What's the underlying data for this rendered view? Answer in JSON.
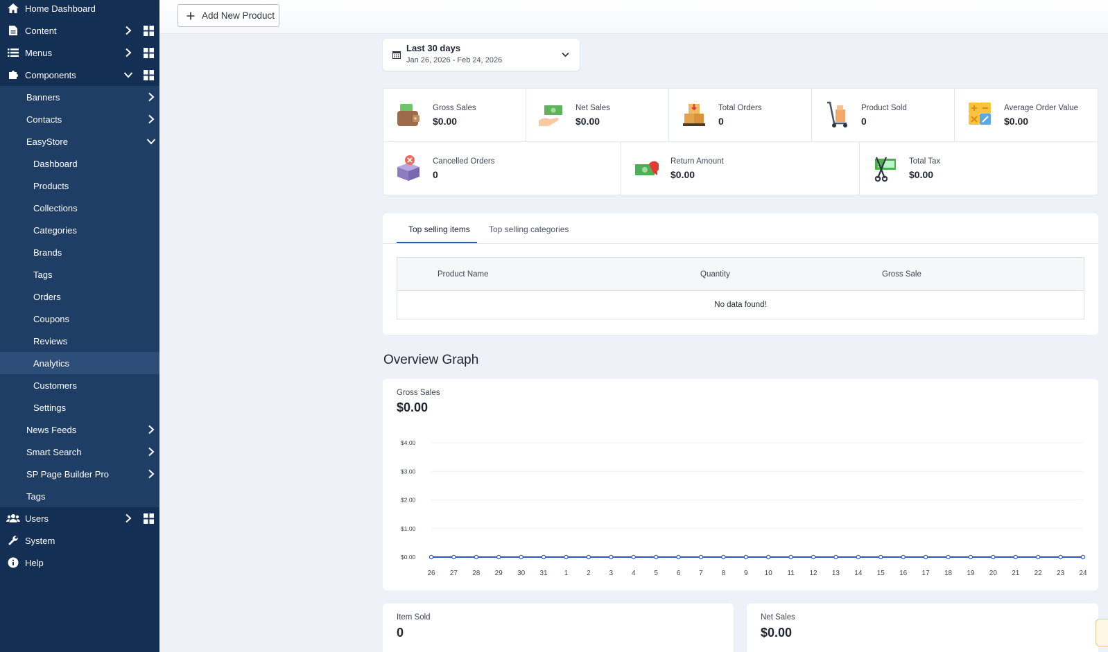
{
  "sidebar": {
    "items": [
      {
        "label": "Home Dashboard"
      },
      {
        "label": "Content"
      },
      {
        "label": "Menus"
      },
      {
        "label": "Components"
      },
      {
        "label": "Banners"
      },
      {
        "label": "Contacts"
      },
      {
        "label": "EasyStore"
      },
      {
        "label": "Dashboard"
      },
      {
        "label": "Products"
      },
      {
        "label": "Collections"
      },
      {
        "label": "Categories"
      },
      {
        "label": "Brands"
      },
      {
        "label": "Tags"
      },
      {
        "label": "Orders"
      },
      {
        "label": "Coupons"
      },
      {
        "label": "Reviews"
      },
      {
        "label": "Analytics"
      },
      {
        "label": "Customers"
      },
      {
        "label": "Settings"
      },
      {
        "label": "News Feeds"
      },
      {
        "label": "Smart Search"
      },
      {
        "label": "SP Page Builder Pro"
      },
      {
        "label": "Tags"
      },
      {
        "label": "Users"
      },
      {
        "label": "System"
      },
      {
        "label": "Help"
      }
    ],
    "active": "Analytics"
  },
  "toolbar": {
    "add_label": "Add New Product"
  },
  "date_range": {
    "label": "Last 30 days",
    "range": "Jan 26, 2026 - Feb 24, 2026"
  },
  "metrics": [
    {
      "label": "Gross Sales",
      "value": "$0.00",
      "icon": "wallet-icon"
    },
    {
      "label": "Net Sales",
      "value": "$0.00",
      "icon": "cash-hand-icon"
    },
    {
      "label": "Total Orders",
      "value": "0",
      "icon": "boxes-icon"
    },
    {
      "label": "Product Sold",
      "value": "0",
      "icon": "hand-truck-icon"
    },
    {
      "label": "Average Order Value",
      "value": "$0.00",
      "icon": "calculator-icon"
    },
    {
      "label": "Cancelled Orders",
      "value": "0",
      "icon": "cancel-box-icon"
    },
    {
      "label": "Return Amount",
      "value": "$0.00",
      "icon": "money-return-icon"
    },
    {
      "label": "Total Tax",
      "value": "$0.00",
      "icon": "tax-scissors-icon"
    }
  ],
  "tabs": [
    {
      "label": "Top selling items"
    },
    {
      "label": "Top selling categories"
    }
  ],
  "table": {
    "headers": [
      "Product Name",
      "Quantity",
      "Gross Sale"
    ],
    "empty": "No data found!"
  },
  "overview": {
    "title": "Overview Graph",
    "gross_label": "Gross Sales",
    "gross_value": "$0.00"
  },
  "chart_data": {
    "type": "line",
    "x": [
      "26",
      "27",
      "28",
      "29",
      "30",
      "31",
      "1",
      "2",
      "3",
      "4",
      "5",
      "6",
      "7",
      "8",
      "9",
      "10",
      "11",
      "12",
      "13",
      "14",
      "15",
      "16",
      "17",
      "18",
      "19",
      "20",
      "21",
      "22",
      "23",
      "24"
    ],
    "series": [
      {
        "values": [
          0,
          0,
          0,
          0,
          0,
          0,
          0,
          0,
          0,
          0,
          0,
          0,
          0,
          0,
          0,
          0,
          0,
          0,
          0,
          0,
          0,
          0,
          0,
          0,
          0,
          0,
          0,
          0,
          0,
          0
        ]
      }
    ],
    "yticks": [
      "$0.00",
      "$1.00",
      "$2.00",
      "$3.00",
      "$4.00"
    ],
    "ylim": [
      0,
      4
    ],
    "color": "#2b55c8",
    "grid": true
  },
  "bottom_cards": [
    {
      "label": "Item Sold",
      "value": "0"
    },
    {
      "label": "Net Sales",
      "value": "$0.00"
    }
  ]
}
